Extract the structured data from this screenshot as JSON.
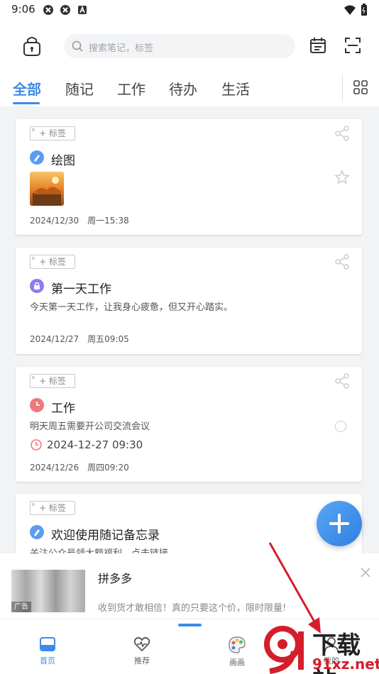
{
  "status_bar": {
    "time": "9:06"
  },
  "search": {
    "placeholder": "搜索笔记，标签"
  },
  "tabs": [
    {
      "label": "全部",
      "active": true
    },
    {
      "label": "随记"
    },
    {
      "label": "工作"
    },
    {
      "label": "待办"
    },
    {
      "label": "生活"
    }
  ],
  "tag_button_label": "+ 标签",
  "notes": [
    {
      "title": "绘图",
      "category": "随记",
      "icon": "pen-icon",
      "icon_color": "#5b9cf0",
      "has_image": true,
      "date": "2024/12/30　周一15:38"
    },
    {
      "title": "第一天工作",
      "category": "生活",
      "icon": "lock-icon",
      "icon_color": "#8d7cf2",
      "body": "今天第一天工作，让我身心疲惫，但又开心踏实。",
      "date": "2024/12/27　周五09:05"
    },
    {
      "title": "工作",
      "category": "待办",
      "icon": "clock-icon",
      "icon_color": "#f07878",
      "body": "明天周五需要开公司交流会议",
      "reminder": "2024-12-27 09:30",
      "date": "2024/12/26　周四09:20"
    },
    {
      "title": "欢迎使用随记备忘录",
      "category": "随记",
      "icon": "pen-icon",
      "icon_color": "#5b9cf0",
      "body": "关注公众号领大额福利，点击链接"
    }
  ],
  "ad": {
    "title": "拼多多",
    "desc": "收到货才敢相信！真的只要这个价，限时限量!",
    "tag": "广告"
  },
  "bottom_nav": [
    {
      "label": "首页",
      "active": true
    },
    {
      "label": "推荐"
    },
    {
      "label": "画画"
    },
    {
      "label": "我的"
    }
  ],
  "watermark": {
    "title": "下载站",
    "sub": "91xz.net"
  },
  "colors": {
    "accent": "#3d8be8",
    "background": "#f2f3f5"
  }
}
